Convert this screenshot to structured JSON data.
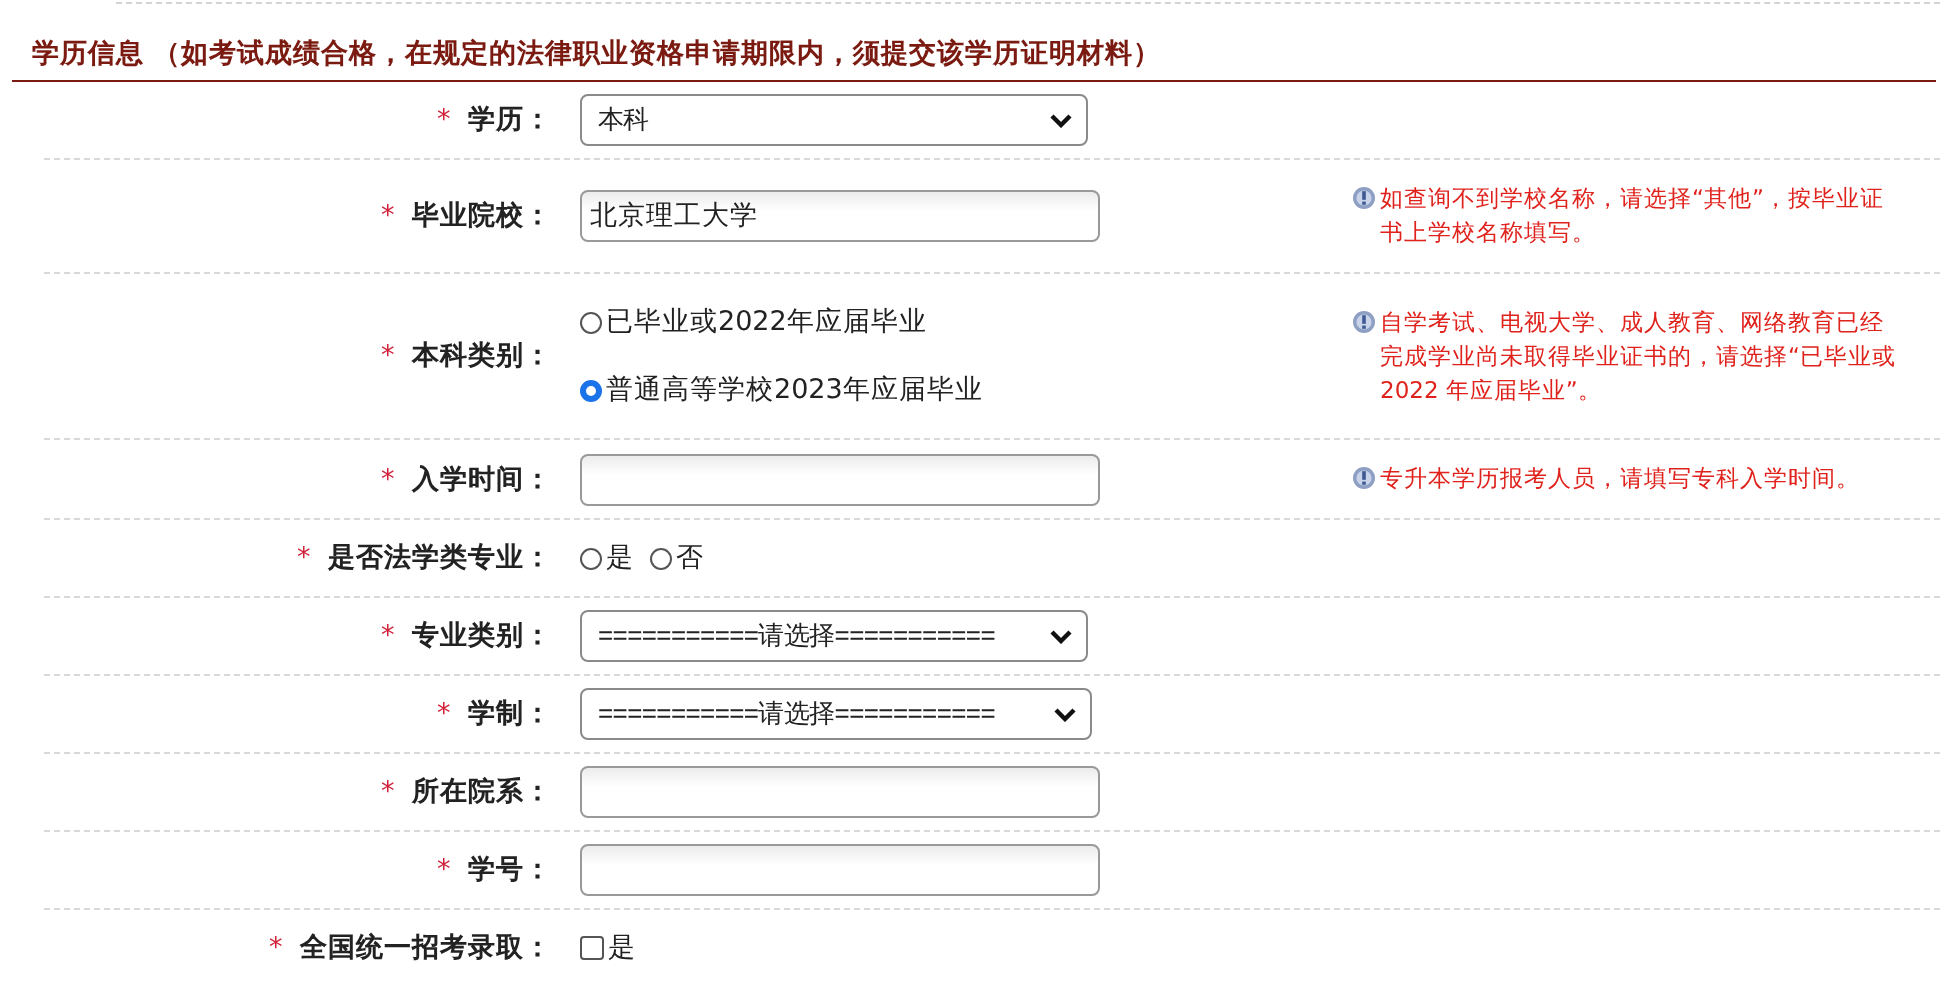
{
  "section_title": "学历信息 （如考试成绩合格，在规定的法律职业资格申请期限内，须提交该学历证明材料）",
  "rows": [
    {
      "kind": "select",
      "required_mark": "*",
      "label": "学历：",
      "value": "本科"
    },
    {
      "kind": "text",
      "required_mark": "*",
      "label": "毕业院校：",
      "value": "北京理工大学",
      "hint": "如查询不到学校名称，请选择“其他”，按毕业证书上学校名称填写。"
    },
    {
      "kind": "radio_list",
      "required_mark": "*",
      "label": "本科类别：",
      "options": [
        {
          "label": "已毕业或2022年应届毕业",
          "selected": false
        },
        {
          "label": "普通高等学校2023年应届毕业",
          "selected": true
        }
      ],
      "hint": "自学考试、电视大学、成人教育、网络教育已经完成学业尚未取得毕业证书的，请选择“已毕业或 2022 年应届毕业”。"
    },
    {
      "kind": "text",
      "required_mark": "*",
      "label": "入学时间：",
      "value": "",
      "hint": "专升本学历报考人员，请填写专科入学时间。"
    },
    {
      "kind": "radio",
      "required_mark": "*",
      "label": "是否法学类专业：",
      "options": [
        {
          "label": "是",
          "selected": false
        },
        {
          "label": "否",
          "selected": false
        }
      ]
    },
    {
      "kind": "select",
      "required_mark": "*",
      "label": "专业类别：",
      "value": "===========请选择==========="
    },
    {
      "kind": "select",
      "required_mark": "*",
      "label": "学制：",
      "value": "===========请选择==========="
    },
    {
      "kind": "text",
      "required_mark": "*",
      "label": "所在院系：",
      "value": ""
    },
    {
      "kind": "text",
      "required_mark": "*",
      "label": "学号：",
      "value": ""
    },
    {
      "kind": "checkbox",
      "required_mark": "*",
      "label": "全国统一招考录取：",
      "option": "是",
      "checked": false
    }
  ]
}
